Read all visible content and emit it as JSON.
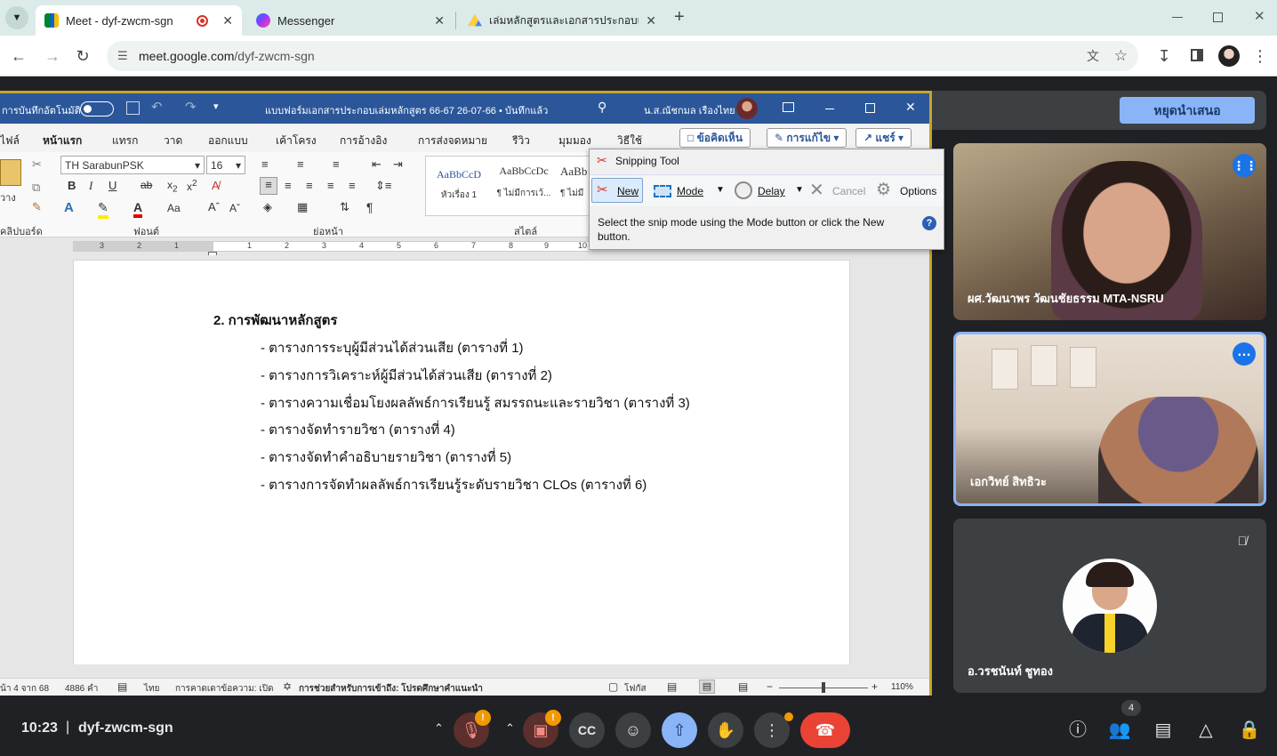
{
  "browser": {
    "tabs": [
      {
        "title": "Meet - dyf-zwcm-sgn",
        "active": true
      },
      {
        "title": "Messenger",
        "active": false
      },
      {
        "title": "เล่มหลักสูตรและเอกสารประกอบเล่มห",
        "active": false
      }
    ],
    "new_tab_label": "+",
    "url_host": "meet.google.com",
    "url_path": "/dyf-zwcm-sgn"
  },
  "meet": {
    "stop_presenting_label": "หยุดนำเสนอ",
    "meeting_code": "dyf-zwcm-sgn",
    "time": "10:23",
    "separator": "|",
    "people_count": "4",
    "mic_warning": "!",
    "cam_warning": "!",
    "participants": [
      {
        "name": "ผศ.วัฒนาพร วัฒนชัยธรรม MTA-NSRU"
      },
      {
        "name": "เอกวิทย์ สิทธิวะ"
      },
      {
        "name": "อ.วรชนันท์ ชูทอง"
      }
    ]
  },
  "word": {
    "autosave_label": "การบันทึกอัตโนมัติ",
    "doc_title": "แบบฟอร์มเอกสารประกอบเล่มหลักสูตร 66-67 26-07-66 • บันทึกแล้ว",
    "user_name": "น.ส.ณัชกมล เรืองไทย",
    "menu": [
      "ไฟล์",
      "หน้าแรก",
      "แทรก",
      "วาด",
      "ออกแบบ",
      "เค้าโครง",
      "การอ้างอิง",
      "การส่งจดหมาย",
      "รีวิว",
      "มุมมอง",
      "วิธีใช้"
    ],
    "comment_label": "ข้อคิดเห็น",
    "edit_label": "การแก้ไข",
    "share_label": "แชร์",
    "font_name": "TH SarabunPSK",
    "font_size": "16",
    "paste_label": "วาง",
    "clipboard_label": "คลิปบอร์ด",
    "font_group_label": "ฟอนต์",
    "paragraph_group_label": "ย่อหน้า",
    "styles_group_label": "สไตล์",
    "styles": [
      {
        "preview": "AaBbCcD",
        "name": "หัวเรื่อง 1"
      },
      {
        "preview": "AaBbCcDc",
        "name": "¶ ไม่มีการเว้..."
      },
      {
        "preview": "AaBb",
        "name": "¶ ไม่มี"
      }
    ],
    "heading": "2. การพัฒนาหลักสูตร",
    "bullets": [
      "- ตารางการระบุผู้มีส่วนได้ส่วนเสีย (ตารางที่ 1)",
      "- ตารางการวิเคราะห์ผู้มีส่วนได้ส่วนเสีย (ตารางที่ 2)",
      "- ตารางความเชื่อมโยงผลลัพธ์การเรียนรู้ สมรรถนะและรายวิชา (ตารางที่ 3)",
      "- ตารางจัดทำรายวิชา (ตารางที่ 4)",
      "- ตารางจัดทำคำอธิบายรายวิชา (ตารางที่ 5)",
      "- ตารางการจัดทำผลลัพธ์การเรียนรู้ระดับรายวิชา CLOs (ตารางที่ 6)"
    ],
    "status": {
      "page": "น้า 4 จาก 68",
      "words": "4886 คำ",
      "language": "ไทย",
      "predict": "การคาดเดาข้อความ: เปิด",
      "accessibility": "การช่วยสำหรับการเข้าถึง: โปรดศึกษาคำแนะนำ",
      "focus": "โฟกัส",
      "zoom": "110%"
    },
    "ruler_labels": [
      "3",
      "2",
      "1",
      "1",
      "2",
      "3",
      "4",
      "5",
      "6",
      "7",
      "8",
      "9",
      "10"
    ]
  },
  "snipping": {
    "title": "Snipping Tool",
    "new_label": "New",
    "mode_label": "Mode",
    "delay_label": "Delay",
    "cancel_label": "Cancel",
    "options_label": "Options",
    "message": "Select the snip mode using the Mode button or click the New button.",
    "help_label": "?"
  }
}
